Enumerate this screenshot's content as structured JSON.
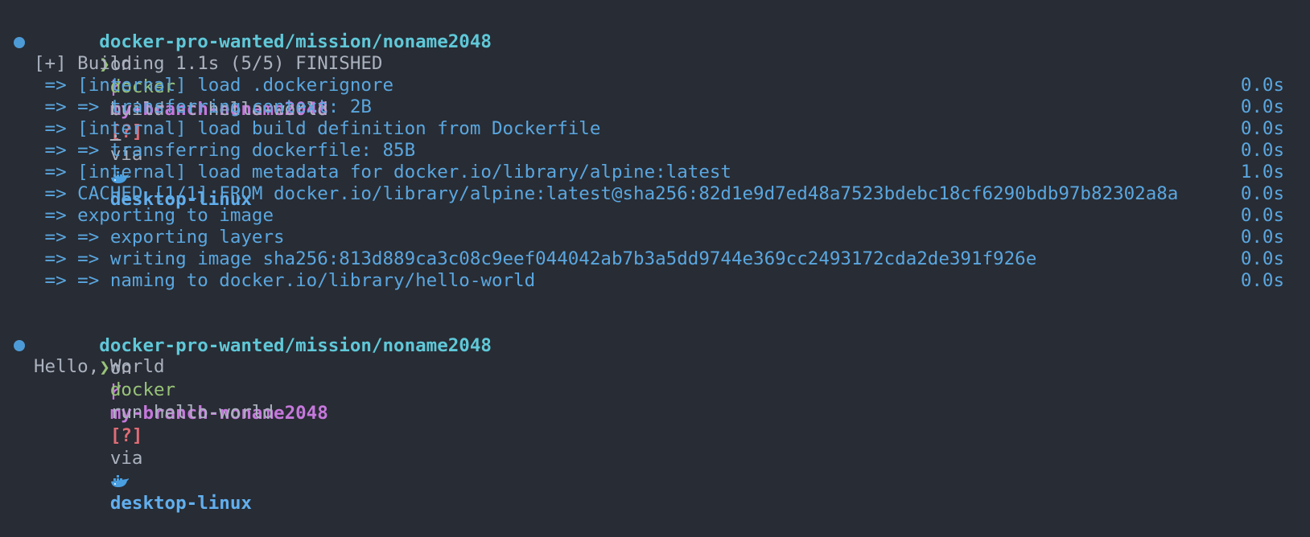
{
  "prompt": {
    "path": "docker-pro-wanted/mission/noname2048",
    "on": "on",
    "branch_icon": "git-branch-icon",
    "branch": "my-branch-noname2048",
    "status": "[?]",
    "via": "via",
    "context_icon": "whale-icon",
    "context": "desktop-linux",
    "symbol": "❯"
  },
  "commands": [
    {
      "cmd": "docker",
      "args": "build -t hello-world",
      "trail": "."
    },
    {
      "cmd": "docker",
      "args": "run hello-world"
    }
  ],
  "build": {
    "header": "[+] Building 1.1s (5/5) FINISHED",
    "steps": [
      {
        "text": " => [internal] load .dockerignore",
        "time": "0.0s"
      },
      {
        "text": " => => transferring context: 2B",
        "time": "0.0s"
      },
      {
        "text": " => [internal] load build definition from Dockerfile",
        "time": "0.0s"
      },
      {
        "text": " => => transferring dockerfile: 85B",
        "time": "0.0s"
      },
      {
        "text": " => [internal] load metadata for docker.io/library/alpine:latest",
        "time": "1.0s"
      },
      {
        "text": " => CACHED [1/1] FROM docker.io/library/alpine:latest@sha256:82d1e9d7ed48a7523bdebc18cf6290bdb97b82302a8a",
        "time": "0.0s"
      },
      {
        "text": " => exporting to image",
        "time": "0.0s"
      },
      {
        "text": " => => exporting layers",
        "time": "0.0s"
      },
      {
        "text": " => => writing image sha256:813d889ca3c08c9eef044042ab7b3a5dd9744e369cc2493172cda2de391f926e",
        "time": "0.0s"
      },
      {
        "text": " => => naming to docker.io/library/hello-world",
        "time": "0.0s"
      }
    ]
  },
  "output": "Hello, World",
  "colors": {
    "background": "#282c34",
    "path": "#5fc8d8",
    "branch": "#c678dd",
    "status": "#e06c75",
    "context": "#61afef",
    "command": "#98c379",
    "build_step": "#5aa7e0"
  }
}
